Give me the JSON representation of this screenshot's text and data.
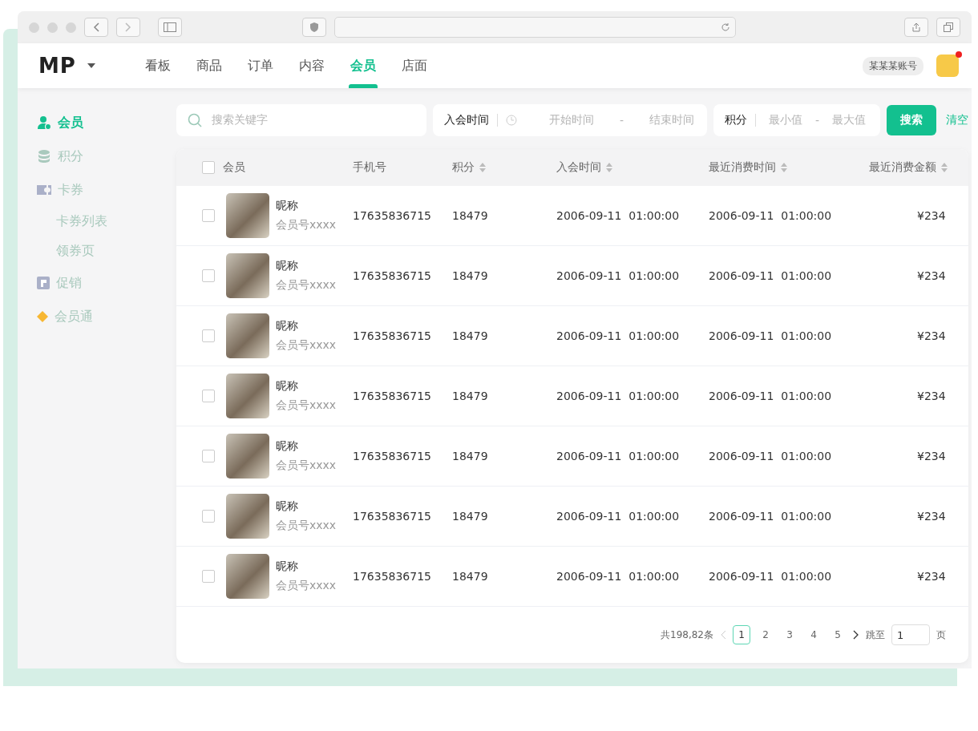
{
  "header": {
    "logo": "MP",
    "nav": [
      {
        "label": "看板",
        "selected": false
      },
      {
        "label": "商品",
        "selected": false
      },
      {
        "label": "订单",
        "selected": false
      },
      {
        "label": "内容",
        "selected": false
      },
      {
        "label": "会员",
        "selected": true
      },
      {
        "label": "店面",
        "selected": false
      }
    ],
    "account": "某某某账号",
    "notification": true
  },
  "sidebar": {
    "items": [
      {
        "label": "会员",
        "kind": "member",
        "selected": true
      },
      {
        "label": "积分",
        "kind": "points",
        "selected": false
      },
      {
        "label": "卡券",
        "kind": "coupon",
        "selected": false,
        "children": [
          {
            "label": "卡券列表",
            "selected": false
          },
          {
            "label": "领券页",
            "selected": false
          }
        ]
      },
      {
        "label": "促销",
        "kind": "promo",
        "selected": false
      },
      {
        "label": "会员通",
        "kind": "diamond",
        "selected": false
      }
    ]
  },
  "filters": {
    "search": {
      "placeholder": "搜索关键字"
    },
    "join_time": {
      "label": "入会时间",
      "start_placeholder": "开始时间",
      "separator": "-",
      "end_placeholder": "结束时间"
    },
    "points": {
      "label": "积分",
      "min_placeholder": "最小值",
      "separator": "-",
      "max_placeholder": "最大值"
    },
    "search_button": "搜索",
    "clear_link": "清空"
  },
  "table": {
    "select_all_checked": false,
    "columns": [
      {
        "label": "会员",
        "sortable": false
      },
      {
        "label": "手机号",
        "sortable": false
      },
      {
        "label": "积分",
        "sortable": true
      },
      {
        "label": "入会时间",
        "sortable": true
      },
      {
        "label": "最近消费时间",
        "sortable": true
      },
      {
        "label": "最近消费金额",
        "sortable": true
      }
    ],
    "rows": [
      {
        "checked": false,
        "nickname": "昵称",
        "member_no": "会员号xxxx",
        "phone": "17635836715",
        "points": "18479",
        "join_time": "2006-09-11  01:00:00",
        "last_time": "2006-09-11  01:00:00",
        "last_amount": "¥234"
      },
      {
        "checked": false,
        "nickname": "昵称",
        "member_no": "会员号xxxx",
        "phone": "17635836715",
        "points": "18479",
        "join_time": "2006-09-11  01:00:00",
        "last_time": "2006-09-11  01:00:00",
        "last_amount": "¥234"
      },
      {
        "checked": false,
        "nickname": "昵称",
        "member_no": "会员号xxxx",
        "phone": "17635836715",
        "points": "18479",
        "join_time": "2006-09-11  01:00:00",
        "last_time": "2006-09-11  01:00:00",
        "last_amount": "¥234"
      },
      {
        "checked": false,
        "nickname": "昵称",
        "member_no": "会员号xxxx",
        "phone": "17635836715",
        "points": "18479",
        "join_time": "2006-09-11  01:00:00",
        "last_time": "2006-09-11  01:00:00",
        "last_amount": "¥234"
      },
      {
        "checked": false,
        "nickname": "昵称",
        "member_no": "会员号xxxx",
        "phone": "17635836715",
        "points": "18479",
        "join_time": "2006-09-11  01:00:00",
        "last_time": "2006-09-11  01:00:00",
        "last_amount": "¥234"
      },
      {
        "checked": false,
        "nickname": "昵称",
        "member_no": "会员号xxxx",
        "phone": "17635836715",
        "points": "18479",
        "join_time": "2006-09-11  01:00:00",
        "last_time": "2006-09-11  01:00:00",
        "last_amount": "¥234"
      },
      {
        "checked": false,
        "nickname": "昵称",
        "member_no": "会员号xxxx",
        "phone": "17635836715",
        "points": "18479",
        "join_time": "2006-09-11  01:00:00",
        "last_time": "2006-09-11  01:00:00",
        "last_amount": "¥234"
      }
    ]
  },
  "pagination": {
    "total": "共198,82条",
    "pages": [
      {
        "label": "1",
        "selected": true
      },
      {
        "label": "2",
        "selected": false
      },
      {
        "label": "3",
        "selected": false
      },
      {
        "label": "4",
        "selected": false
      },
      {
        "label": "5",
        "selected": false
      }
    ],
    "jump_label": "跳至",
    "jump_value": "1",
    "unit": "页"
  }
}
